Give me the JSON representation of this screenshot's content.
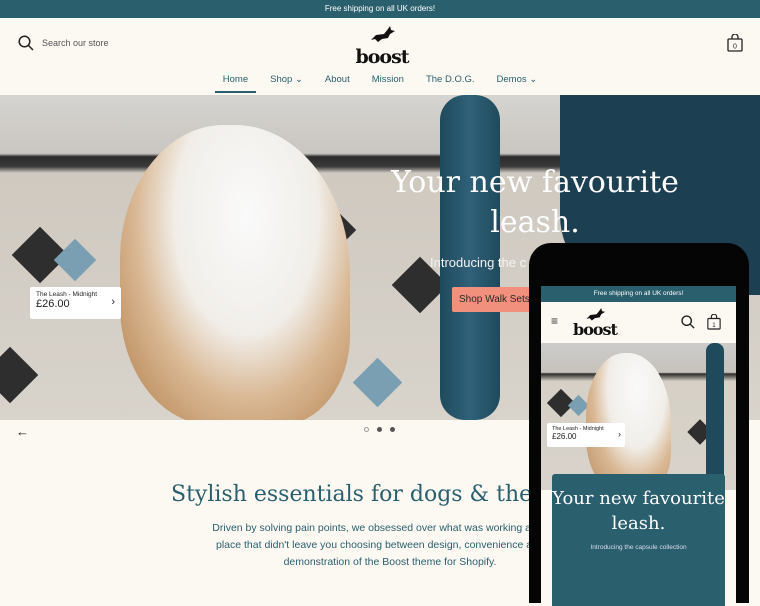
{
  "announcement": "Free shipping on all UK orders!",
  "header": {
    "search_placeholder": "Search our store",
    "logo": "boost",
    "cart_count": "0"
  },
  "nav": [
    {
      "label": "Home",
      "active": true
    },
    {
      "label": "Shop",
      "dropdown": true
    },
    {
      "label": "About"
    },
    {
      "label": "Mission"
    },
    {
      "label": "The D.O.G."
    },
    {
      "label": "Demos",
      "dropdown": true
    }
  ],
  "hero": {
    "title": "Your new favourite leash.",
    "subtitle": "Introducing the c",
    "button": "Shop Walk Sets",
    "product": {
      "name": "The Leash - Midnight",
      "price": "£26.00"
    },
    "slide_count": 3,
    "active_slide": 1
  },
  "intro": {
    "heading": "Stylish essentials for dogs & their hu",
    "line1": "Driven by solving pain points, we obsessed over what was working and what",
    "line2": "place that didn't leave you choosing between design, convenience and affo",
    "line3": "demonstration of the Boost theme for Shopify."
  },
  "mobile": {
    "announcement": "Free shipping on all UK orders!",
    "logo": "boost",
    "cart_count": "1",
    "product": {
      "name": "The Leash - Midnight",
      "price": "£26.00"
    },
    "title": "Your new favourite leash.",
    "subtitle": "Introducing the capsule collection"
  },
  "colors": {
    "brand": "#2a5f6e",
    "button": "#f1907c",
    "background": "#fcf9f3"
  }
}
